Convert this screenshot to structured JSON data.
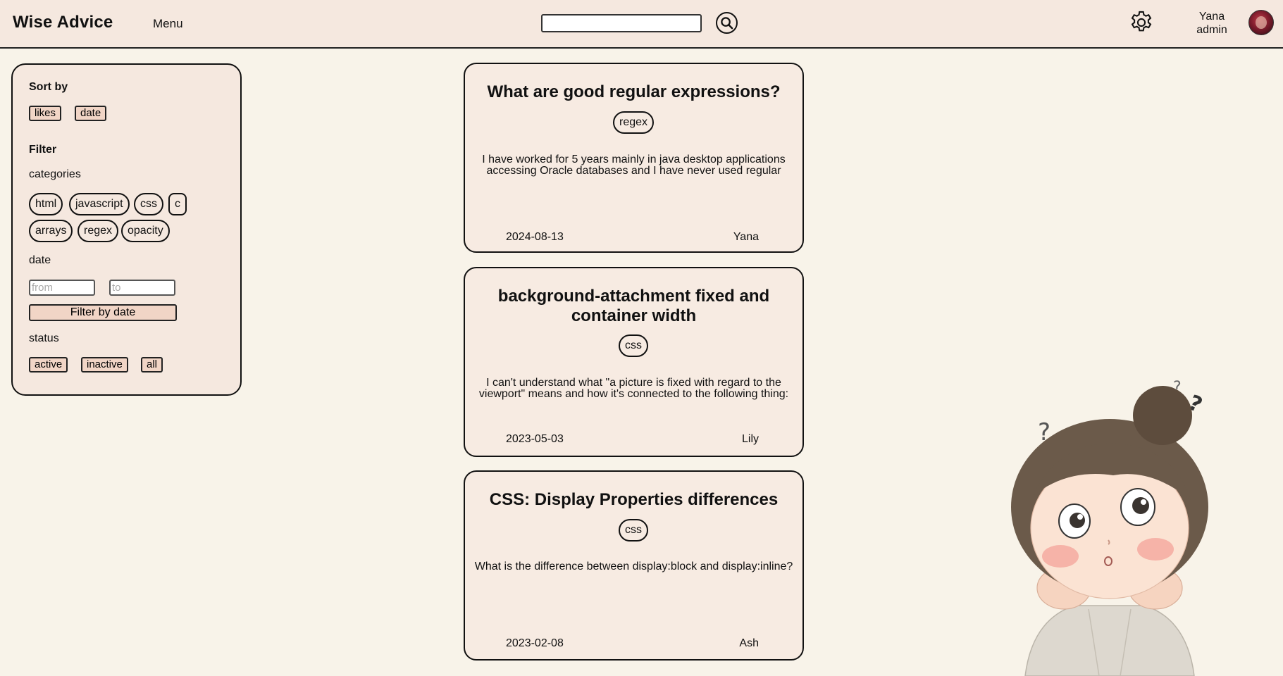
{
  "header": {
    "brand": "Wise Advice",
    "menu_label": "Menu",
    "search": {
      "value": "",
      "placeholder": ""
    },
    "search_icon": "search-icon",
    "settings_icon": "gear-icon",
    "user": {
      "name": "Yana",
      "role": "admin"
    }
  },
  "sidebar": {
    "sort_title": "Sort by",
    "sort_options": [
      "likes",
      "date"
    ],
    "filter_title": "Filter",
    "categories_label": "categories",
    "categories": [
      "html",
      "javascript",
      "css",
      "c",
      "arrays",
      "regex",
      "opacity"
    ],
    "date_label": "date",
    "date_from_placeholder": "from",
    "date_to_placeholder": "to",
    "filter_date_button": "Filter by date",
    "status_label": "status",
    "status_options": [
      "active",
      "inactive",
      "all"
    ]
  },
  "posts": [
    {
      "title": "What are good regular expressions?",
      "tag": "regex",
      "body": "I have worked for 5 years mainly in java desktop applications accessing Oracle databases and I have never used regular",
      "date": "2024-08-13",
      "author": "Yana"
    },
    {
      "title": "background-attachment fixed and container width",
      "tag": "css",
      "body": "I can't understand what \"a picture is fixed with regard to the viewport\" means and how it's connected to the following thing:",
      "date": "2023-05-03",
      "author": "Lily"
    },
    {
      "title": "CSS: Display Properties differences",
      "tag": "css",
      "body": "What is the difference between display:block and display:inline?",
      "date": "2023-02-08",
      "author": "Ash"
    }
  ],
  "colors": {
    "page_bg": "#f8f3e9",
    "header_bg": "#f5e8df",
    "button_fill": "#f1d5c6",
    "border": "#111111"
  }
}
